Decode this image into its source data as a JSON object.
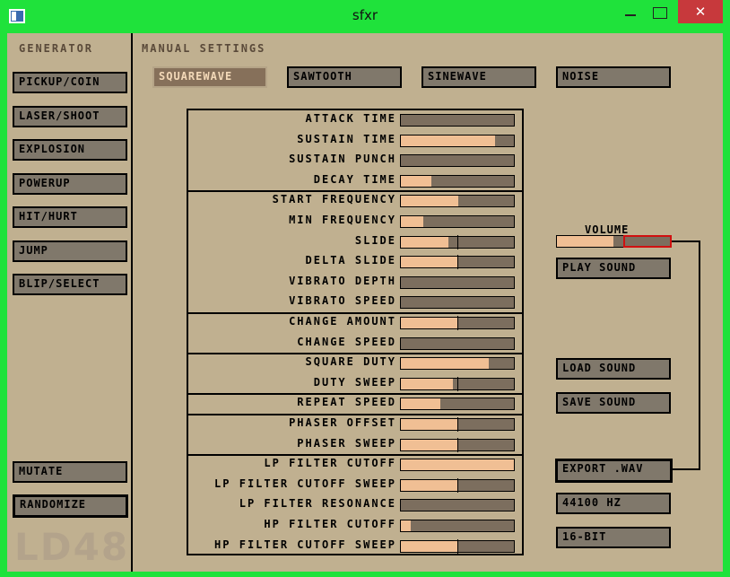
{
  "window": {
    "title": "sfxr",
    "close_glyph": "✕"
  },
  "generator": {
    "heading": "GENERATOR",
    "buttons": [
      "PICKUP/COIN",
      "LASER/SHOOT",
      "EXPLOSION",
      "POWERUP",
      "HIT/HURT",
      "JUMP",
      "BLIP/SELECT"
    ],
    "mutate": "MUTATE",
    "randomize": "RANDOMIZE",
    "logo": "LD48"
  },
  "manual": {
    "heading": "MANUAL SETTINGS",
    "waveforms": [
      "SQUAREWAVE",
      "SAWTOOTH",
      "SINEWAVE",
      "NOISE"
    ],
    "selected_waveform": "SQUAREWAVE"
  },
  "sliders": [
    {
      "label": "ATTACK TIME",
      "value": 0.0,
      "bipolar": false
    },
    {
      "label": "SUSTAIN TIME",
      "value": 0.83,
      "bipolar": false
    },
    {
      "label": "SUSTAIN PUNCH",
      "value": 0.0,
      "bipolar": false
    },
    {
      "label": "DECAY TIME",
      "value": 0.27,
      "bipolar": false
    },
    {
      "label": "START FREQUENCY",
      "value": 0.51,
      "bipolar": false
    },
    {
      "label": "MIN FREQUENCY",
      "value": 0.2,
      "bipolar": false
    },
    {
      "label": "SLIDE",
      "value": 0.42,
      "bipolar": true
    },
    {
      "label": "DELTA SLIDE",
      "value": 0.5,
      "bipolar": true
    },
    {
      "label": "VIBRATO DEPTH",
      "value": 0.0,
      "bipolar": false
    },
    {
      "label": "VIBRATO SPEED",
      "value": 0.0,
      "bipolar": false
    },
    {
      "label": "CHANGE AMOUNT",
      "value": 0.5,
      "bipolar": true
    },
    {
      "label": "CHANGE SPEED",
      "value": 0.0,
      "bipolar": false
    },
    {
      "label": "SQUARE DUTY",
      "value": 0.78,
      "bipolar": false
    },
    {
      "label": "DUTY SWEEP",
      "value": 0.46,
      "bipolar": true
    },
    {
      "label": "REPEAT SPEED",
      "value": 0.35,
      "bipolar": false
    },
    {
      "label": "PHASER OFFSET",
      "value": 0.5,
      "bipolar": true
    },
    {
      "label": "PHASER SWEEP",
      "value": 0.5,
      "bipolar": true
    },
    {
      "label": "LP FILTER CUTOFF",
      "value": 1.0,
      "bipolar": false
    },
    {
      "label": "LP FILTER CUTOFF SWEEP",
      "value": 0.5,
      "bipolar": true
    },
    {
      "label": "LP FILTER RESONANCE",
      "value": 0.0,
      "bipolar": false
    },
    {
      "label": "HP FILTER CUTOFF",
      "value": 0.09,
      "bipolar": false
    },
    {
      "label": "HP FILTER CUTOFF SWEEP",
      "value": 0.5,
      "bipolar": true
    }
  ],
  "volume": {
    "label": "VOLUME",
    "value": 0.5
  },
  "actions": {
    "play": "PLAY SOUND",
    "load": "LOAD SOUND",
    "save": "SAVE SOUND",
    "export": "EXPORT .WAV",
    "samplerate": "44100 HZ",
    "bitdepth": "16-BIT"
  },
  "colors": {
    "frame": "#1fe23b",
    "background": "#c0b090",
    "slider_fill": "#f0bf94",
    "slider_track": "#7c6e5e",
    "button": "#80786b",
    "close": "#c7393c"
  }
}
